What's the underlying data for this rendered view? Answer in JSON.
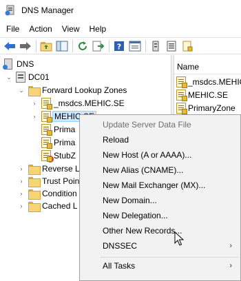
{
  "window": {
    "title": "DNS Manager"
  },
  "menubar": {
    "items": [
      "File",
      "Action",
      "View",
      "Help"
    ]
  },
  "toolbar": {
    "buttons": [
      "back-arrow-icon",
      "forward-arrow-icon",
      "up-folder-icon",
      "show-hide-tree-icon",
      "refresh-icon",
      "export-list-icon",
      "help-icon",
      "properties-icon",
      "server-icon",
      "list-icon",
      "zone-icon"
    ]
  },
  "tree": {
    "root": "DNS",
    "server": "DC01",
    "forward_zones": "Forward Lookup Zones",
    "zones": [
      "_msdcs.MEHIC.SE",
      "MEHIC.SE",
      "Prima",
      "Prima",
      "StubZ"
    ],
    "folders": [
      "Reverse L",
      "Trust Poin",
      "Condition",
      "Cached L"
    ]
  },
  "list": {
    "header": "Name",
    "items": [
      "_msdcs.MEHIC",
      "MEHIC.SE",
      "PrimaryZone"
    ]
  },
  "context_menu": {
    "items": [
      {
        "label": "Update Server Data File",
        "disabled": true
      },
      {
        "label": "Reload"
      },
      {
        "label": "New Host (A or AAAA)..."
      },
      {
        "label": "New Alias (CNAME)..."
      },
      {
        "label": "New Mail Exchanger (MX)..."
      },
      {
        "label": "New Domain..."
      },
      {
        "label": "New Delegation..."
      },
      {
        "label": "Other New Records..."
      },
      {
        "label": "DNSSEC",
        "submenu": true
      },
      {
        "label": "All Tasks",
        "submenu": true
      }
    ]
  },
  "colors": {
    "selection": "#cce8ff",
    "menu_bg": "#f2f2f2",
    "folder": "#f6d57a"
  }
}
